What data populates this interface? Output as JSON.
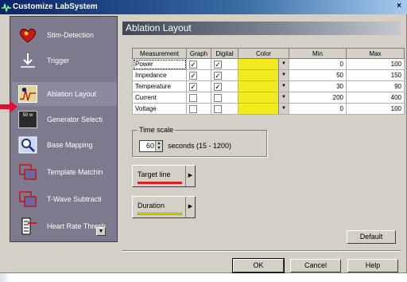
{
  "window": {
    "title": "Customize LabSystem",
    "close_label": "×"
  },
  "sidebar": {
    "items": [
      {
        "label": "Stim-Detection",
        "icon": "heart-icon"
      },
      {
        "label": "Trigger",
        "icon": "trigger-icon"
      },
      {
        "label": "Ablation Layout",
        "icon": "ablation-icon",
        "active": true
      },
      {
        "label": "Generator Selecti",
        "icon": "generator-icon"
      },
      {
        "label": "Base Mapping",
        "icon": "magnifier-icon"
      },
      {
        "label": "Template Matchin",
        "icon": "template-icon"
      },
      {
        "label": "T-Wave Subtracti",
        "icon": "twave-icon"
      },
      {
        "label": "Heart Rate Thresh",
        "icon": "threshold-icon"
      }
    ],
    "generator_badge": "50 w",
    "scroll_glyph": "▼"
  },
  "main": {
    "title": "Ablation Layout",
    "table": {
      "headers": [
        "Measurement",
        "Graph",
        "Digital",
        "Color",
        "Min",
        "Max"
      ],
      "rows": [
        {
          "measurement": "Power",
          "graph": true,
          "digital": true,
          "color": "#f2ea1c",
          "min": "0",
          "max": "100"
        },
        {
          "measurement": "Impedance",
          "graph": true,
          "digital": true,
          "color": "#f2ea1c",
          "min": "50",
          "max": "150"
        },
        {
          "measurement": "Temperature",
          "graph": true,
          "digital": true,
          "color": "#f2ea1c",
          "min": "30",
          "max": "90"
        },
        {
          "measurement": "Current",
          "graph": false,
          "digital": false,
          "color": "#f2ea1c",
          "min": "200",
          "max": "400"
        },
        {
          "measurement": "Voltage",
          "graph": false,
          "digital": false,
          "color": "#f2ea1c",
          "min": "0",
          "max": "100"
        }
      ]
    },
    "time_scale": {
      "group_label": "Time scale",
      "value": "60",
      "units_label": "seconds (15 - 1200)"
    },
    "target_line": {
      "label": "Target line",
      "line_color": "#e02020"
    },
    "duration": {
      "label": "Duration",
      "line_color": "#f2ea1c"
    },
    "default_button": "Default"
  },
  "footer": {
    "ok": "OK",
    "cancel": "Cancel",
    "help": "Help"
  },
  "colors": {
    "accent_title": "#0a246a",
    "swatch_yellow": "#f2ea1c",
    "arrow_red": "#e01030"
  }
}
